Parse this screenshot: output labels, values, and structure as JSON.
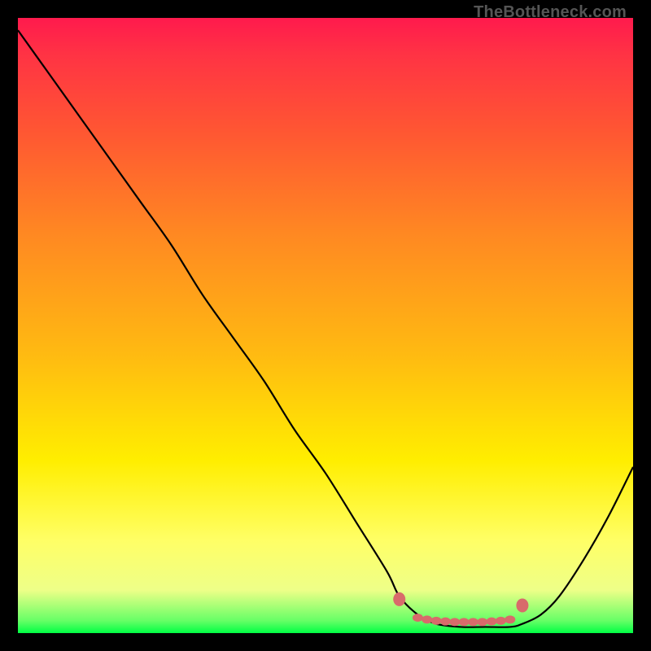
{
  "watermark": "TheBottleneck.com",
  "chart_data": {
    "type": "line",
    "title": "",
    "xlabel": "",
    "ylabel": "",
    "xlim": [
      0,
      100
    ],
    "ylim": [
      0,
      100
    ],
    "series": [
      {
        "name": "bottleneck-curve",
        "x": [
          0,
          5,
          10,
          15,
          20,
          25,
          30,
          35,
          40,
          45,
          50,
          55,
          60,
          62,
          65,
          68,
          72,
          76,
          80,
          82,
          85,
          88,
          92,
          96,
          100
        ],
        "values": [
          98,
          91,
          84,
          77,
          70,
          63,
          55,
          48,
          41,
          33,
          26,
          18,
          10,
          6,
          3,
          1.5,
          1,
          1,
          1,
          1.5,
          3,
          6,
          12,
          19,
          27
        ]
      }
    ],
    "markers": {
      "name": "highlight-dots",
      "x": [
        62,
        65,
        66.5,
        68,
        69.5,
        71,
        72.5,
        74,
        75.5,
        77,
        78.5,
        80,
        82
      ],
      "values": [
        5.5,
        2.5,
        2.2,
        2,
        1.9,
        1.8,
        1.8,
        1.8,
        1.8,
        1.9,
        2,
        2.2,
        4.5
      ]
    },
    "gradient_stops": [
      {
        "pos": 0,
        "color": "#ff1a4d"
      },
      {
        "pos": 6,
        "color": "#ff3344"
      },
      {
        "pos": 18,
        "color": "#ff5533"
      },
      {
        "pos": 35,
        "color": "#ff8822"
      },
      {
        "pos": 55,
        "color": "#ffbb11"
      },
      {
        "pos": 72,
        "color": "#ffee00"
      },
      {
        "pos": 85,
        "color": "#ffff66"
      },
      {
        "pos": 93,
        "color": "#eeff88"
      },
      {
        "pos": 98,
        "color": "#66ff66"
      },
      {
        "pos": 100,
        "color": "#00ff44"
      }
    ]
  }
}
